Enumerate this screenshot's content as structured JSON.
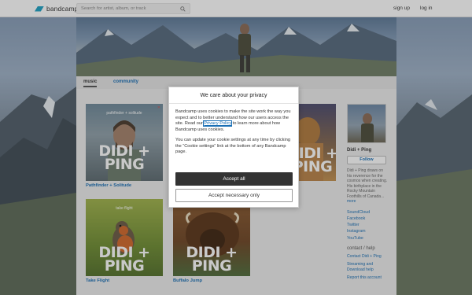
{
  "brand": {
    "name": "bandcamp",
    "accent": "#1da0c3"
  },
  "header": {
    "search_placeholder": "Search for artist, album, or track",
    "signup": "sign up",
    "login": "log in"
  },
  "tabs": {
    "music": "music",
    "community": "community"
  },
  "albums": [
    {
      "title": "Pathfinder + Solitude",
      "cover_label": "pathfinder + solitude",
      "art_text": "DIDI + PING"
    },
    {
      "title": "Take Flight",
      "cover_label": "take flight",
      "art_text": "DIDI + PING"
    },
    {
      "title": "Buffalo Jump",
      "cover_label": "",
      "art_text": "DIDI + PING"
    }
  ],
  "sidebar": {
    "artist": "Didi + Ping",
    "follow": "Follow",
    "bio": "Didi + Ping draws on his reverence for the cosmos when creating. His birthplace in the Rocky Mountain Foothills of Canada...",
    "bio_more": "more",
    "links": [
      "SoundCloud",
      "Facebook",
      "Twitter",
      "Instagram",
      "YouTube"
    ],
    "contact_heading": "contact / help",
    "contact_link": "Contact Didi + Ping",
    "streaming_link": "Streaming and Download help",
    "report_link": "Report this account"
  },
  "cookie_dialog": {
    "title": "We care about your privacy",
    "para1_before": "Bandcamp uses cookies to make the site work the way you expect and to better understand how our users access the site. Read our ",
    "privacy_link": "Privacy Policy",
    "para1_after": " to learn more about how Bandcamp uses cookies.",
    "para2": "You can update your cookie settings at any time by clicking the “Cookie settings” link at the bottom of any Bandcamp page.",
    "accept_all": "Accept all",
    "accept_necessary": "Accept necessary only"
  }
}
